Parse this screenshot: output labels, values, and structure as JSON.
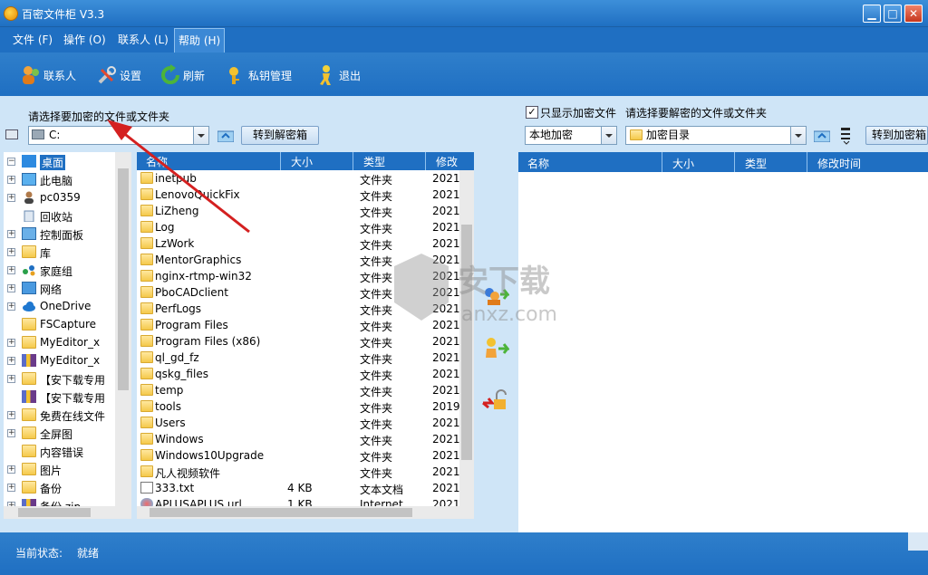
{
  "window": {
    "title": "百密文件柜 V3.3"
  },
  "menu": [
    "文件 (F)",
    "操作 (O)",
    "联系人 (L)",
    "帮助 (H)"
  ],
  "toolbar": [
    "联系人",
    "设置",
    "刷新",
    "私钥管理",
    "退出"
  ],
  "left": {
    "label": "请选择要加密的文件或文件夹",
    "drive": "C:",
    "goto_button": "转到解密箱",
    "tree": [
      {
        "label": "桌面",
        "icon": "desktop-icon",
        "selected": true
      },
      {
        "label": "此电脑",
        "icon": "computer-icon"
      },
      {
        "label": "pc0359",
        "icon": "user-icon"
      },
      {
        "label": "回收站",
        "icon": "recycle-bin-icon"
      },
      {
        "label": "控制面板",
        "icon": "control-panel-icon"
      },
      {
        "label": "库",
        "icon": "library-icon"
      },
      {
        "label": "家庭组",
        "icon": "homegroup-icon"
      },
      {
        "label": "网络",
        "icon": "network-icon"
      },
      {
        "label": "OneDrive",
        "icon": "cloud-icon"
      },
      {
        "label": "FSCapture",
        "icon": "folder-icon"
      },
      {
        "label": "MyEditor_x",
        "icon": "folder-icon"
      },
      {
        "label": "MyEditor_x",
        "icon": "archive-icon"
      },
      {
        "label": "【安下载专用",
        "icon": "folder-icon"
      },
      {
        "label": "【安下载专用",
        "icon": "archive-icon"
      },
      {
        "label": "免费在线文件",
        "icon": "folder-icon"
      },
      {
        "label": "全屏图",
        "icon": "folder-icon"
      },
      {
        "label": "内容错误",
        "icon": "folder-icon"
      },
      {
        "label": "图片",
        "icon": "folder-icon"
      },
      {
        "label": "备份",
        "icon": "folder-icon"
      },
      {
        "label": "备份.zip",
        "icon": "archive-icon"
      }
    ],
    "columns": [
      "名称",
      "大小",
      "类型",
      "修改"
    ],
    "files": [
      {
        "name": "inetpub",
        "size": "",
        "type": "文件夹",
        "date": "2021-"
      },
      {
        "name": "LenovoQuickFix",
        "size": "",
        "type": "文件夹",
        "date": "2021-"
      },
      {
        "name": "LiZheng",
        "size": "",
        "type": "文件夹",
        "date": "2021-"
      },
      {
        "name": "Log",
        "size": "",
        "type": "文件夹",
        "date": "2021-"
      },
      {
        "name": "LzWork",
        "size": "",
        "type": "文件夹",
        "date": "2021-"
      },
      {
        "name": "MentorGraphics",
        "size": "",
        "type": "文件夹",
        "date": "2021-"
      },
      {
        "name": "nginx-rtmp-win32",
        "size": "",
        "type": "文件夹",
        "date": "2021-"
      },
      {
        "name": "PboCADclient",
        "size": "",
        "type": "文件夹",
        "date": "2021-"
      },
      {
        "name": "PerfLogs",
        "size": "",
        "type": "文件夹",
        "date": "2021-"
      },
      {
        "name": "Program Files",
        "size": "",
        "type": "文件夹",
        "date": "2021-"
      },
      {
        "name": "Program Files (x86)",
        "size": "",
        "type": "文件夹",
        "date": "2021-"
      },
      {
        "name": "ql_gd_fz",
        "size": "",
        "type": "文件夹",
        "date": "2021-"
      },
      {
        "name": "qskg_files",
        "size": "",
        "type": "文件夹",
        "date": "2021-"
      },
      {
        "name": "temp",
        "size": "",
        "type": "文件夹",
        "date": "2021-"
      },
      {
        "name": "tools",
        "size": "",
        "type": "文件夹",
        "date": "2019-"
      },
      {
        "name": "Users",
        "size": "",
        "type": "文件夹",
        "date": "2021-"
      },
      {
        "name": "Windows",
        "size": "",
        "type": "文件夹",
        "date": "2021-"
      },
      {
        "name": "Windows10Upgrade",
        "size": "",
        "type": "文件夹",
        "date": "2021-"
      },
      {
        "name": "凡人视频软件",
        "size": "",
        "type": "文件夹",
        "date": "2021-"
      },
      {
        "name": "333.txt",
        "size": "4 KB",
        "type": "文本文档",
        "date": "2021-"
      },
      {
        "name": "APLUSAPLUS.url",
        "size": "1 KB",
        "type": "Internet ...",
        "date": "2021-"
      }
    ]
  },
  "right": {
    "checkbox_label": "只显示加密文件",
    "label": "请选择要解密的文件或文件夹",
    "location": "本地加密",
    "directory": "加密目录",
    "goto_button": "转到加密箱",
    "columns": [
      "名称",
      "大小",
      "类型",
      "修改时间"
    ]
  },
  "status": {
    "label": "当前状态:",
    "value": "就绪"
  },
  "watermark": {
    "text": "安下载",
    "sub": "anxz.com"
  },
  "colors": {
    "accent": "#1f6fc2",
    "panel": "#cfe5f7",
    "annotation": "#d42020"
  }
}
